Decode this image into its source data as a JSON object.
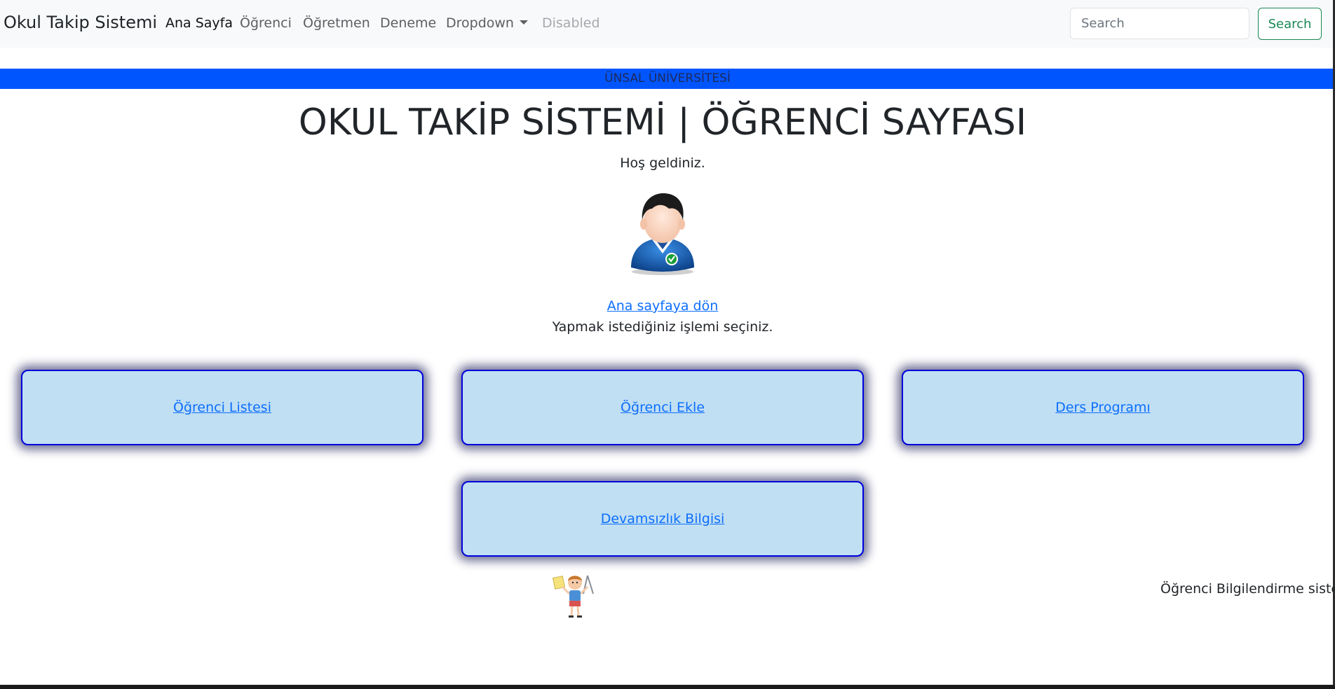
{
  "navbar": {
    "brand": "Okul Takip Sistemi",
    "links": [
      {
        "label": "Ana Sayfa",
        "state": "active"
      },
      {
        "label": "Öğrenci",
        "state": "normal"
      },
      {
        "label": "Öğretmen",
        "state": "normal"
      },
      {
        "label": "Deneme",
        "state": "normal"
      },
      {
        "label": "Dropdown",
        "state": "dropdown"
      },
      {
        "label": "Disabled",
        "state": "disabled"
      }
    ],
    "search": {
      "placeholder": "Search",
      "value": "",
      "button_label": "Search"
    }
  },
  "banner": {
    "text": "ÜNSAL ÜNİVERSİTESİ",
    "color": "#0055ff"
  },
  "main": {
    "title": "OKUL TAKİP SİSTEMİ | ÖĞRENCİ SAYFASI",
    "welcome": "Hoş geldiniz.",
    "avatar_icon": "student-avatar-icon",
    "home_link": "Ana sayfaya dön",
    "instruction": "Yapmak istediğiniz işlemi seçiniz.",
    "cards": [
      {
        "label": "Öğrenci Listesi"
      },
      {
        "label": "Öğrenci Ekle"
      },
      {
        "label": "Ders Programı"
      },
      {
        "label": "Devamsızlık Bilgisi"
      }
    ]
  },
  "footer": {
    "kid_icon": "student-kid-icon",
    "text": "Öğrenci Bilgilendirme sisten"
  },
  "colors": {
    "card_bg": "#c0dff3",
    "card_border": "#0000dd",
    "link": "#0d6efd",
    "search_button": "#198754"
  }
}
